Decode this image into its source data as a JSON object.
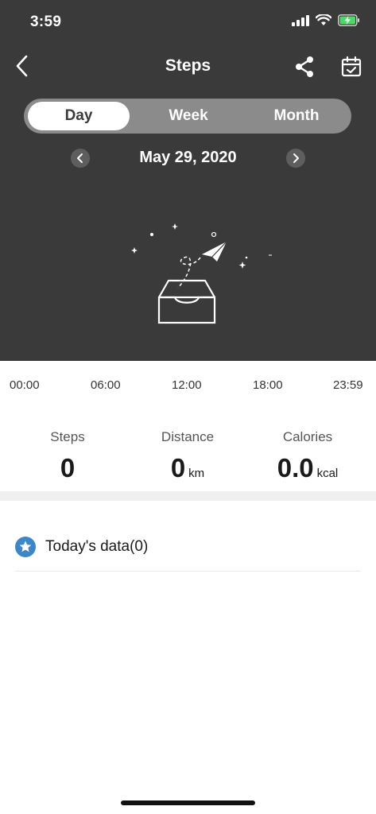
{
  "status_bar": {
    "time": "3:59",
    "icons": [
      "signal-icon",
      "wifi-icon",
      "battery-charging-icon"
    ]
  },
  "nav": {
    "title": "Steps",
    "back_icon": "chevron-left-icon",
    "share_icon": "share-icon",
    "calendar_icon": "calendar-check-icon"
  },
  "segments": {
    "items": [
      "Day",
      "Week",
      "Month"
    ],
    "selected": "Day"
  },
  "date_nav": {
    "date": "May 29, 2020"
  },
  "axis": {
    "ticks": [
      "00:00",
      "06:00",
      "12:00",
      "18:00",
      "23:59"
    ]
  },
  "stats": {
    "steps": {
      "label": "Steps",
      "value": "0",
      "unit": ""
    },
    "distance": {
      "label": "Distance",
      "value": "0",
      "unit": "km"
    },
    "calories": {
      "label": "Calories",
      "value": "0.0",
      "unit": "kcal"
    }
  },
  "today": {
    "label": "Today's data(0)",
    "icon": "star-icon"
  },
  "colors": {
    "header_bg": "#3a3a3a",
    "accent": "#3d86c9",
    "segment_bg": "#8b8b8b"
  }
}
